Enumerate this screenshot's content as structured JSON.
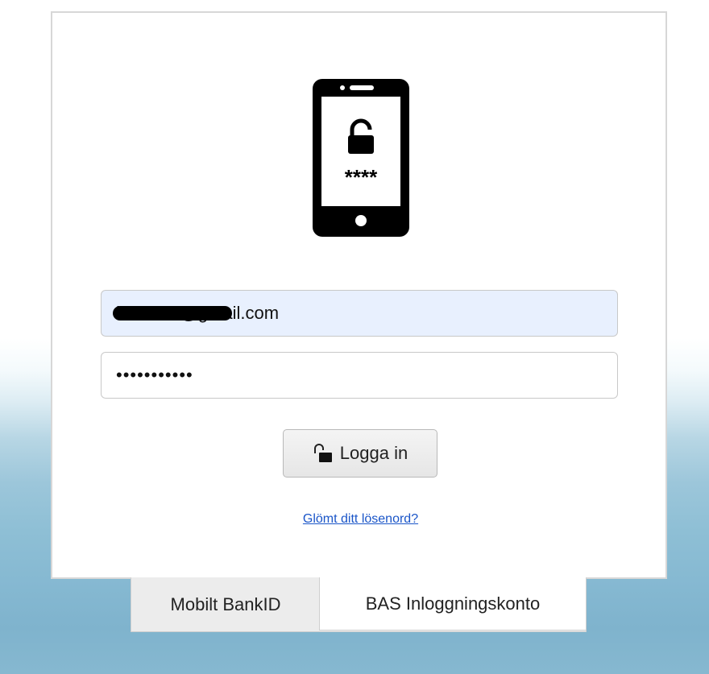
{
  "login": {
    "email_value": "h.........b@gmail.com",
    "email_visible_suffix": "@gmail.com",
    "password_value": "•••••••••••",
    "button_label": "Logga in",
    "forgot_link": "Glömt ditt lösenord?"
  },
  "phone_icon": {
    "pin_text": "****",
    "icon": "phone-unlock-icon"
  },
  "tabs": [
    {
      "label": "Mobilt BankID",
      "active": false
    },
    {
      "label": "BAS Inloggningskonto",
      "active": true
    }
  ],
  "colors": {
    "email_background": "#e8f0fe",
    "link": "#1a55c8"
  }
}
